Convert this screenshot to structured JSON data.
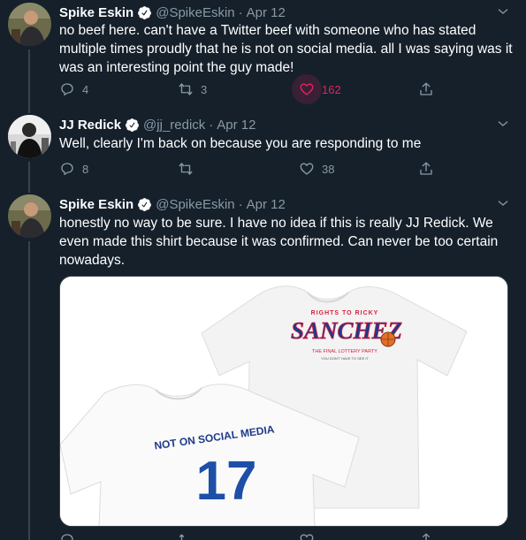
{
  "colors": {
    "background": "#15202b",
    "text": "#ffffff",
    "secondary": "#8899a6",
    "like": "#e0245e",
    "verified": "#ffffff",
    "divider": "#38444d"
  },
  "tweets": [
    {
      "name": "Spike Eskin",
      "handle": "@SpikeEskin",
      "dot": "·",
      "date": "Apr 12",
      "text": "no beef here. can't have a Twitter beef with someone who has stated multiple times proudly that he is not on social media. all I was saying was it was an interesting point the guy made!",
      "replies": "4",
      "retweets": "3",
      "likes": "162",
      "liked": true
    },
    {
      "name": "JJ Redick",
      "handle": "@jj_redick",
      "dot": "·",
      "date": "Apr 12",
      "text": "Well, clearly I'm back on because you are responding to me",
      "replies": "8",
      "retweets": "",
      "likes": "38",
      "liked": false
    },
    {
      "name": "Spike Eskin",
      "handle": "@SpikeEskin",
      "dot": "·",
      "date": "Apr 12",
      "text": "honestly no way to be sure. I have no idea if this is really JJ Redick. We even made this shirt because it was confirmed.  Can never be too certain nowadays.",
      "media": {
        "back_shirt_top_line": "RIGHTS TO RICKY",
        "back_shirt_logo": "SANCHEZ",
        "back_shirt_subtitle": "THE FINAL LOTTERY PARTY",
        "back_shirt_small": "YOU DON'T HAVE TO SEE IT",
        "front_shirt_text": "NOT ON SOCIAL MEDIA",
        "front_shirt_number": "17"
      }
    }
  ],
  "icons": [
    "reply-icon",
    "retweet-icon",
    "like-icon",
    "share-icon",
    "caret-down-icon",
    "verified-icon"
  ]
}
